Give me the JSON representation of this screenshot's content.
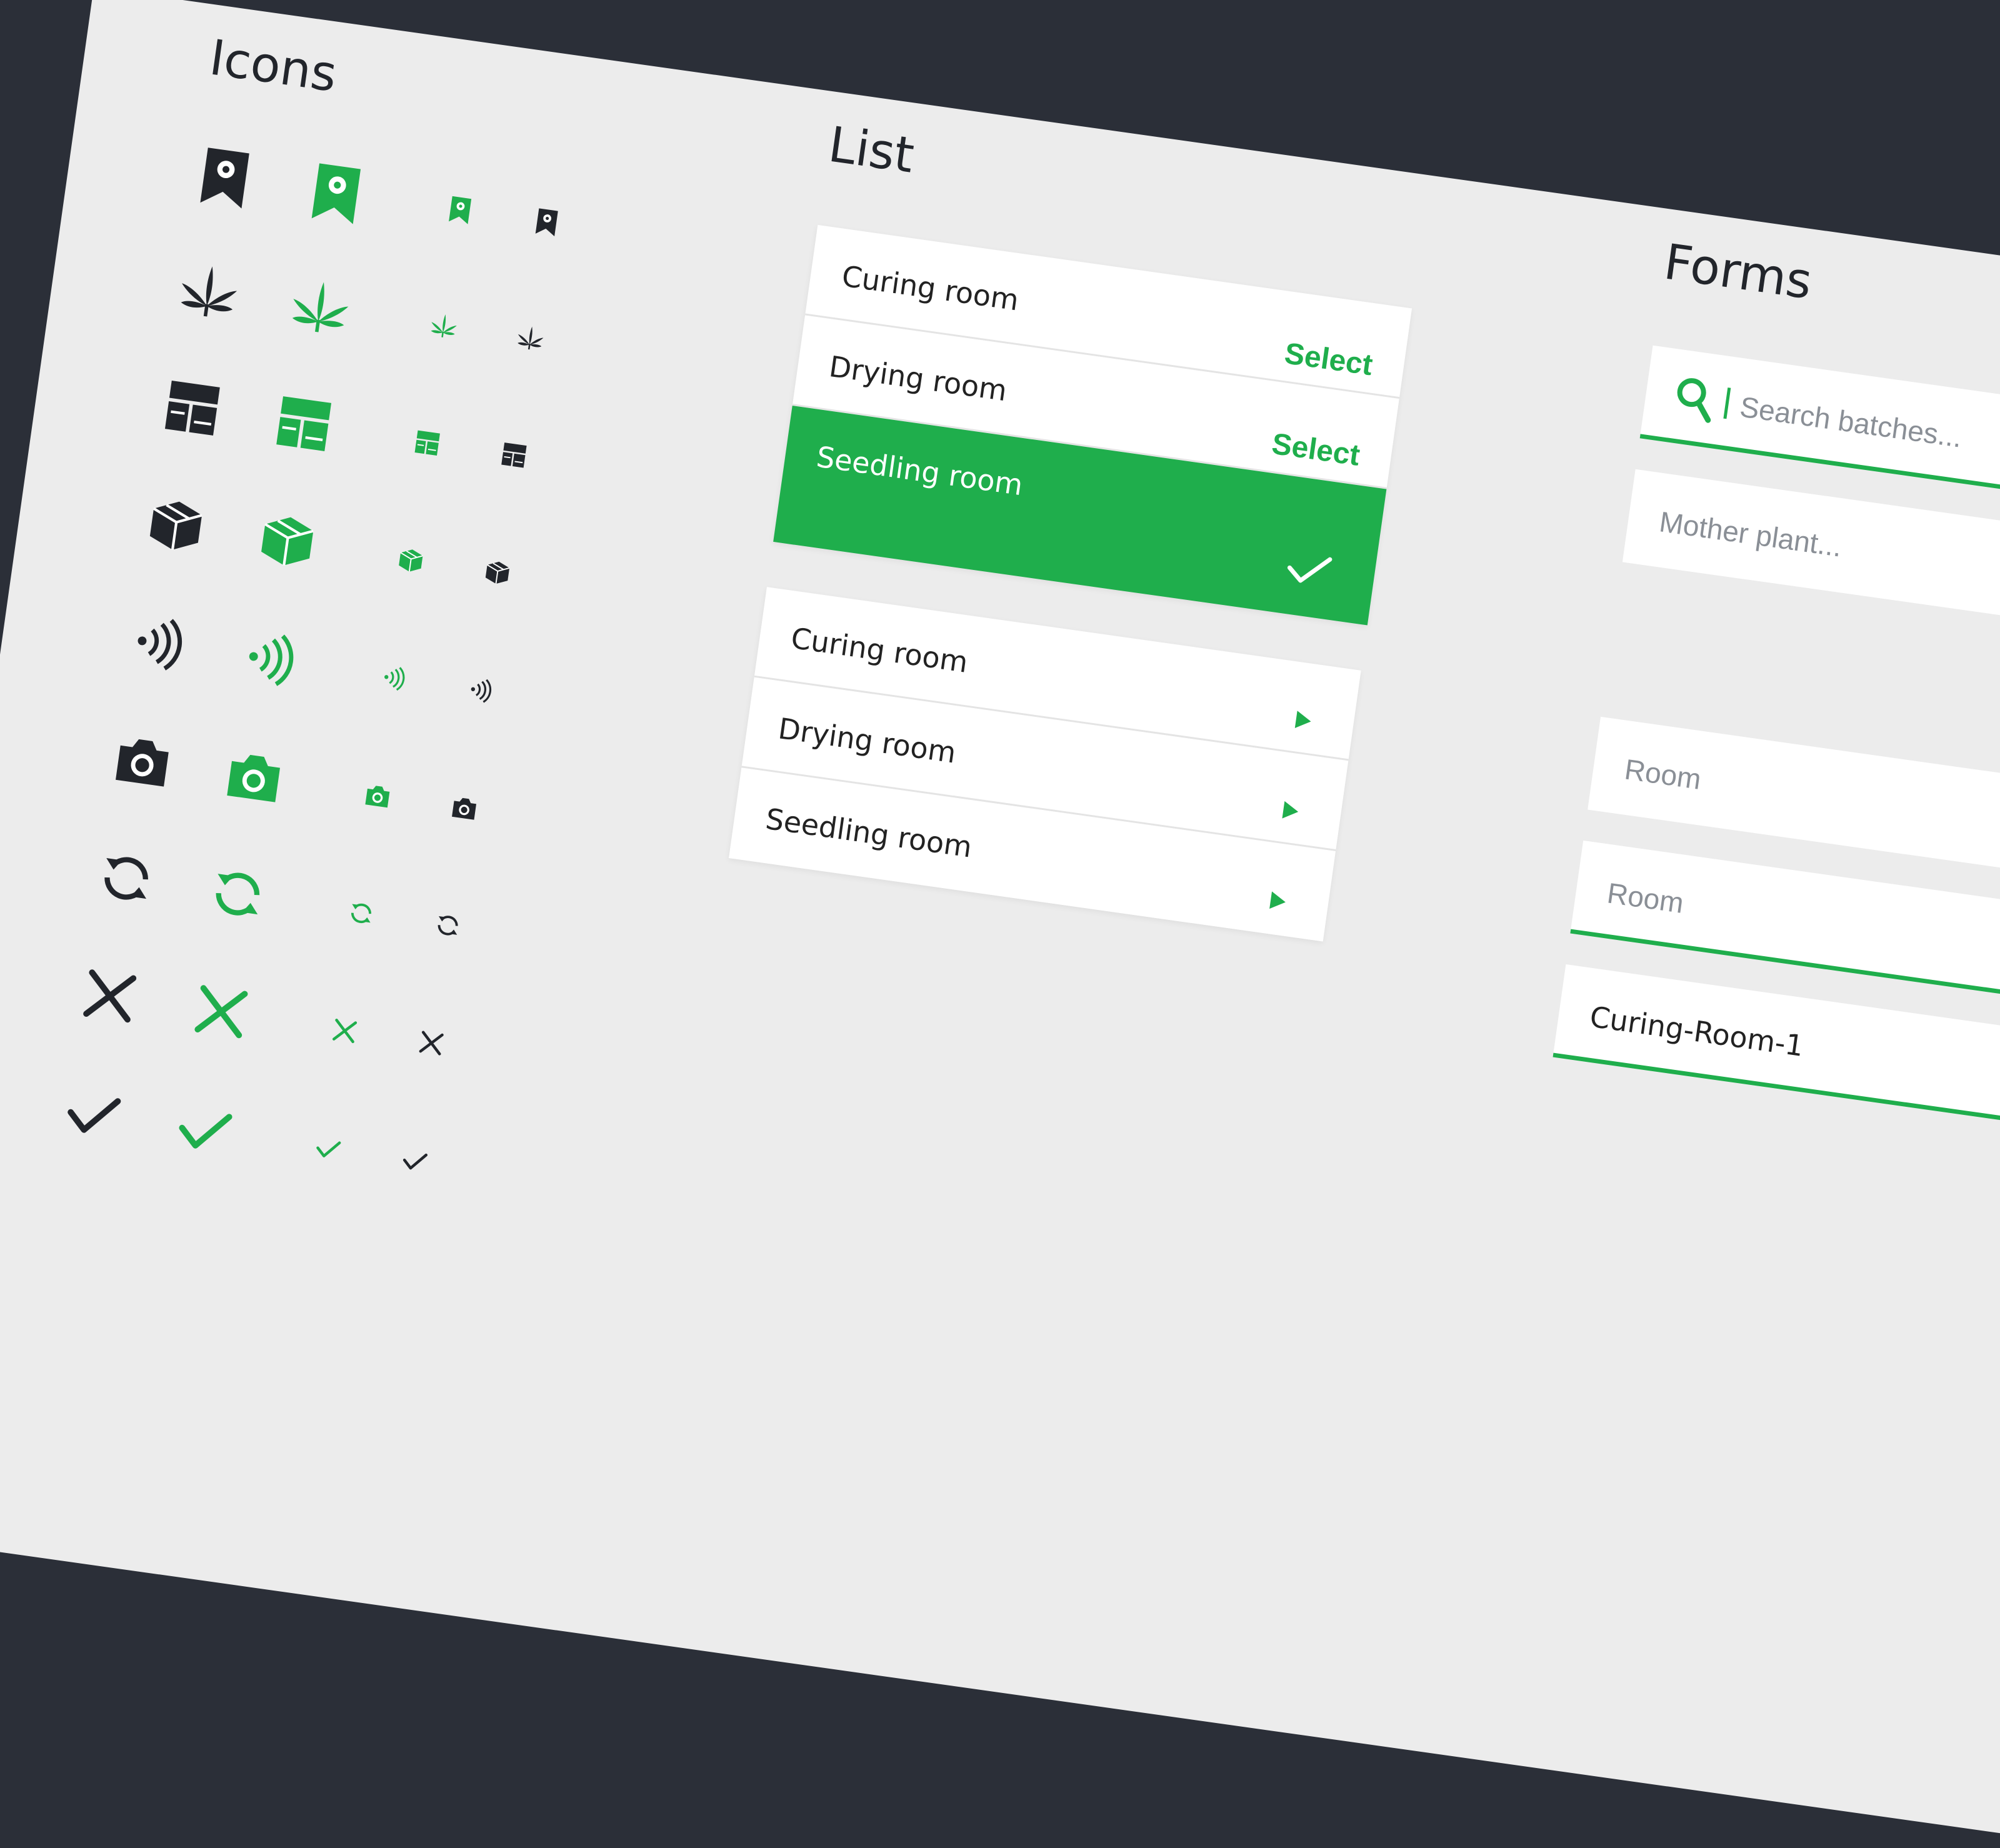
{
  "sections": {
    "icons": "Icons",
    "list": "List",
    "forms": "Forms"
  },
  "colors": {
    "accent": "#1fae4c",
    "dark": "#22252b",
    "background": "#ececec",
    "frame": "#2b2f38"
  },
  "icon_rows": [
    "bookmark-icon",
    "cannabis-leaf-icon",
    "layout-icon",
    "package-icon",
    "nfc-signal-icon",
    "camera-icon",
    "refresh-icon",
    "close-icon",
    "check-icon"
  ],
  "select_list": {
    "items": [
      {
        "label": "Curing room",
        "action": "Select"
      },
      {
        "label": "Drying room",
        "action": "Select"
      },
      {
        "label": "Seedling room",
        "selected": true
      }
    ]
  },
  "nav_list": {
    "items": [
      {
        "label": "Curing room"
      },
      {
        "label": "Drying room"
      },
      {
        "label": "Seedling room"
      }
    ]
  },
  "forms": {
    "search_placeholder": "Search batches...",
    "mother_placeholder": "Mother plant...",
    "room_placeholder_1": "Room",
    "room_placeholder_2": "Room",
    "room_value": "Curing-Room-1"
  }
}
